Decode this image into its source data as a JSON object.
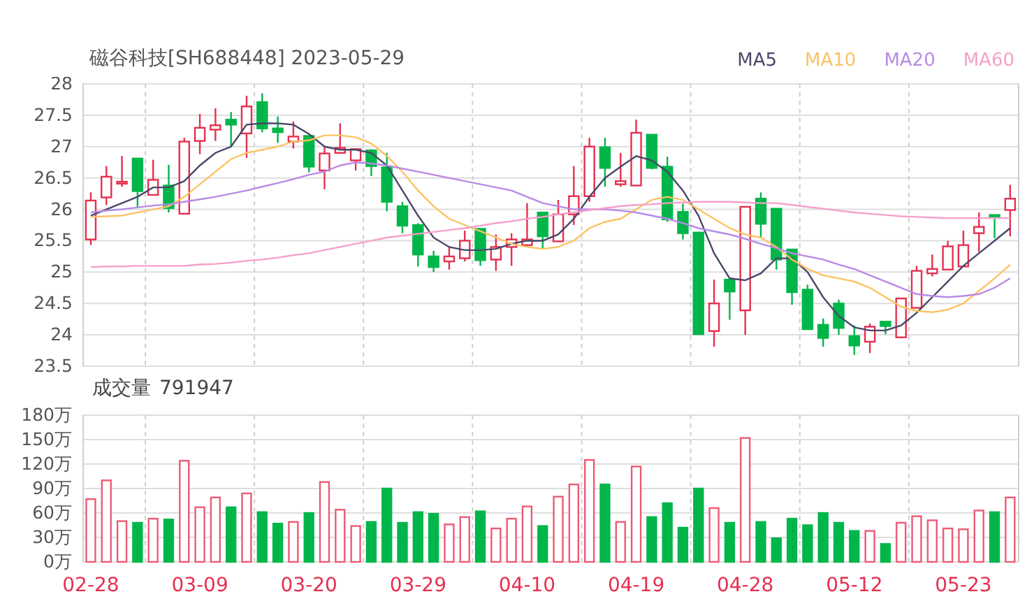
{
  "header": {
    "title": "磁谷科技[SH688448] 2023-05-29"
  },
  "price_chart": {
    "chart_data": {
      "type": "candlestick",
      "grid": true,
      "ylim": [
        23.5,
        28
      ],
      "categories": [
        null,
        null,
        null,
        null,
        null,
        null,
        null,
        null,
        null,
        null,
        null,
        null,
        null,
        null,
        null,
        null,
        null,
        null,
        null,
        null,
        null,
        null,
        null,
        null,
        null,
        null,
        null,
        null,
        null,
        null,
        null,
        null,
        null,
        null,
        null,
        null,
        null,
        null,
        null,
        null,
        null,
        null,
        null,
        null,
        null,
        null,
        null,
        null,
        null,
        null,
        null,
        null,
        null,
        null,
        null,
        null,
        null,
        null,
        null,
        null
      ],
      "yticks": [
        23.5,
        24,
        24.5,
        25,
        25.5,
        26,
        26.5,
        27,
        27.5,
        28
      ],
      "ohlc": [
        [
          25.52,
          26.27,
          25.43,
          26.14
        ],
        [
          26.19,
          26.69,
          26.07,
          26.52
        ],
        [
          26.41,
          26.85,
          26.36,
          26.44
        ],
        [
          26.81,
          26.81,
          26.03,
          26.29
        ],
        [
          26.23,
          26.79,
          26.23,
          26.47
        ],
        [
          26.38,
          26.71,
          25.95,
          26.02
        ],
        [
          25.93,
          27.14,
          25.93,
          27.08
        ],
        [
          27.09,
          27.52,
          26.88,
          27.3
        ],
        [
          27.27,
          27.61,
          27.09,
          27.34
        ],
        [
          27.43,
          27.55,
          27.0,
          27.35
        ],
        [
          27.21,
          27.81,
          26.82,
          27.64
        ],
        [
          27.71,
          27.85,
          27.23,
          27.29
        ],
        [
          27.29,
          27.48,
          27.06,
          27.23
        ],
        [
          27.08,
          27.4,
          26.97,
          27.16
        ],
        [
          27.17,
          27.17,
          26.59,
          26.68
        ],
        [
          26.62,
          26.99,
          26.32,
          26.89
        ],
        [
          26.9,
          27.37,
          26.9,
          26.98
        ],
        [
          26.78,
          26.96,
          26.62,
          26.96
        ],
        [
          26.94,
          26.96,
          26.53,
          26.69
        ],
        [
          26.67,
          26.9,
          25.97,
          26.12
        ],
        [
          26.05,
          26.12,
          25.62,
          25.74
        ],
        [
          25.75,
          25.78,
          25.09,
          25.28
        ],
        [
          25.25,
          25.34,
          25.0,
          25.08
        ],
        [
          25.17,
          25.41,
          25.04,
          25.25
        ],
        [
          25.22,
          25.66,
          25.17,
          25.5
        ],
        [
          25.69,
          25.69,
          25.1,
          25.19
        ],
        [
          25.2,
          25.6,
          25.02,
          25.4
        ],
        [
          25.4,
          25.62,
          25.1,
          25.52
        ],
        [
          25.43,
          26.1,
          25.41,
          25.52
        ],
        [
          25.95,
          25.95,
          25.37,
          25.57
        ],
        [
          25.49,
          26.15,
          25.49,
          25.92
        ],
        [
          25.92,
          26.69,
          25.75,
          26.21
        ],
        [
          26.21,
          27.14,
          26.12,
          27.0
        ],
        [
          26.99,
          27.14,
          26.36,
          26.66
        ],
        [
          26.4,
          26.9,
          26.36,
          26.45
        ],
        [
          26.38,
          27.43,
          26.38,
          27.22
        ],
        [
          27.19,
          27.19,
          26.64,
          26.66
        ],
        [
          26.68,
          26.84,
          25.8,
          25.84
        ],
        [
          25.96,
          26.09,
          25.52,
          25.62
        ],
        [
          25.63,
          25.63,
          24.01,
          24.01
        ],
        [
          24.06,
          24.88,
          23.81,
          24.5
        ],
        [
          24.88,
          24.88,
          24.24,
          24.69
        ],
        [
          24.39,
          26.04,
          24.0,
          26.04
        ],
        [
          26.17,
          26.27,
          25.56,
          25.77
        ],
        [
          26.01,
          26.01,
          25.04,
          25.2
        ],
        [
          25.36,
          25.36,
          24.48,
          24.68
        ],
        [
          24.72,
          24.8,
          24.09,
          24.09
        ],
        [
          24.16,
          24.26,
          23.81,
          23.95
        ],
        [
          24.5,
          24.56,
          24.0,
          24.11
        ],
        [
          23.98,
          24.15,
          23.68,
          23.83
        ],
        [
          23.89,
          24.18,
          23.71,
          24.13
        ],
        [
          24.21,
          24.21,
          24.01,
          24.14
        ],
        [
          23.96,
          24.58,
          23.96,
          24.58
        ],
        [
          24.43,
          25.1,
          24.43,
          25.02
        ],
        [
          24.98,
          25.28,
          24.93,
          25.05
        ],
        [
          25.04,
          25.5,
          25.04,
          25.41
        ],
        [
          25.09,
          25.66,
          25.09,
          25.43
        ],
        [
          25.62,
          25.95,
          25.32,
          25.72
        ],
        [
          25.91,
          25.91,
          25.54,
          25.89
        ],
        [
          25.99,
          26.39,
          25.57,
          26.17
        ]
      ]
    }
  },
  "moving_averages": {
    "chart_data": {
      "type": "line",
      "ylim": [
        23.5,
        28
      ],
      "series": [
        {
          "name": "MA5",
          "color": "#4a4868",
          "values": [
            25.9,
            26.0,
            26.1,
            26.2,
            26.35,
            26.35,
            26.45,
            26.7,
            26.9,
            27.0,
            27.35,
            27.37,
            27.37,
            27.35,
            27.2,
            27.0,
            26.95,
            26.95,
            26.9,
            26.7,
            26.3,
            25.9,
            25.55,
            25.4,
            25.35,
            25.35,
            25.37,
            25.45,
            25.5,
            25.5,
            25.6,
            25.85,
            26.2,
            26.5,
            26.68,
            26.85,
            26.78,
            26.6,
            26.3,
            25.9,
            25.3,
            24.9,
            24.87,
            24.98,
            25.22,
            25.22,
            25.0,
            24.6,
            24.3,
            24.12,
            24.07,
            24.07,
            24.15,
            24.35,
            24.6,
            24.85,
            25.1,
            25.3,
            25.5,
            25.7
          ]
        },
        {
          "name": "MA10",
          "color": "#fbc365",
          "values": [
            25.88,
            25.89,
            25.9,
            25.95,
            26.0,
            26.05,
            26.2,
            26.4,
            26.6,
            26.8,
            26.9,
            26.95,
            27.0,
            27.08,
            27.1,
            27.18,
            27.18,
            27.15,
            27.05,
            26.85,
            26.6,
            26.3,
            26.05,
            25.85,
            25.75,
            25.65,
            25.55,
            25.45,
            25.4,
            25.37,
            25.4,
            25.5,
            25.7,
            25.8,
            25.85,
            26.0,
            26.15,
            26.2,
            26.15,
            26.0,
            25.85,
            25.7,
            25.6,
            25.55,
            25.4,
            25.2,
            25.05,
            24.95,
            24.9,
            24.85,
            24.75,
            24.6,
            24.45,
            24.38,
            24.36,
            24.4,
            24.5,
            24.7,
            24.9,
            25.12
          ]
        },
        {
          "name": "MA20",
          "color": "#b98ae6",
          "values": [
            25.95,
            25.98,
            26.0,
            26.03,
            26.06,
            26.08,
            26.12,
            26.16,
            26.2,
            26.25,
            26.3,
            26.36,
            26.42,
            26.48,
            26.55,
            26.6,
            26.7,
            26.75,
            26.73,
            26.7,
            26.65,
            26.6,
            26.55,
            26.5,
            26.45,
            26.4,
            26.35,
            26.3,
            26.2,
            26.1,
            26.05,
            26.0,
            26.0,
            26.0,
            25.98,
            25.95,
            25.9,
            25.85,
            25.78,
            25.7,
            25.65,
            25.6,
            25.53,
            25.45,
            25.38,
            25.3,
            25.25,
            25.2,
            25.12,
            25.05,
            24.95,
            24.85,
            24.75,
            24.65,
            24.62,
            24.6,
            24.62,
            24.65,
            24.75,
            24.9
          ]
        },
        {
          "name": "MA60",
          "color": "#f5a0c8",
          "values": [
            25.08,
            25.09,
            25.09,
            25.1,
            25.1,
            25.1,
            25.1,
            25.12,
            25.13,
            25.15,
            25.18,
            25.2,
            25.23,
            25.27,
            25.3,
            25.35,
            25.4,
            25.45,
            25.5,
            25.55,
            25.58,
            25.61,
            25.64,
            25.67,
            25.7,
            25.74,
            25.78,
            25.81,
            25.85,
            25.88,
            25.92,
            25.95,
            25.99,
            26.02,
            26.05,
            26.07,
            26.08,
            26.1,
            26.11,
            26.12,
            26.12,
            26.12,
            26.11,
            26.1,
            26.1,
            26.07,
            26.04,
            26.01,
            25.98,
            25.95,
            25.93,
            25.91,
            25.89,
            25.88,
            25.87,
            25.86,
            25.86,
            25.86,
            25.86,
            25.86
          ]
        }
      ]
    }
  },
  "volume_chart": {
    "value": "791947",
    "chart_data": {
      "type": "bar",
      "grid": true,
      "ylim": [
        0,
        180
      ],
      "categories": [
        "02-28",
        null,
        null,
        null,
        null,
        null,
        null,
        "03-09",
        null,
        null,
        null,
        null,
        null,
        null,
        "03-20",
        null,
        null,
        null,
        null,
        null,
        null,
        "03-29",
        null,
        null,
        null,
        null,
        null,
        null,
        "04-10",
        null,
        null,
        null,
        null,
        null,
        null,
        "04-19",
        null,
        null,
        null,
        null,
        null,
        null,
        "04-28",
        null,
        null,
        null,
        null,
        null,
        null,
        "05-12",
        null,
        null,
        null,
        null,
        null,
        null,
        "05-23",
        null,
        null,
        null
      ],
      "yticks": [
        {
          "value": 0,
          "label": "0万"
        },
        {
          "value": 30,
          "label": "30万"
        },
        {
          "value": 60,
          "label": "60万"
        },
        {
          "value": 90,
          "label": "90万"
        },
        {
          "value": 120,
          "label": "120万"
        },
        {
          "value": 150,
          "label": "150万"
        },
        {
          "value": 180,
          "label": "180万"
        }
      ],
      "series": [
        {
          "name": "成交量",
          "values": [
            77,
            100,
            50,
            48,
            53,
            52,
            124,
            67,
            79,
            67,
            84,
            61,
            47,
            49,
            60,
            98,
            64,
            44,
            49,
            90,
            48,
            61,
            59,
            46,
            55,
            62,
            41,
            53,
            68,
            44,
            80,
            95,
            125,
            95,
            49,
            117,
            55,
            72,
            42,
            90,
            66,
            48,
            152,
            49,
            29,
            53,
            45,
            60,
            48,
            38,
            38,
            22,
            48,
            56,
            51,
            41,
            40,
            63,
            61,
            79
          ]
        }
      ]
    }
  }
}
